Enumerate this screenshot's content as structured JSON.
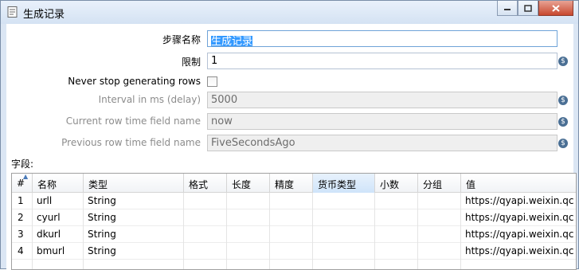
{
  "window": {
    "title": "生成记录",
    "controls": {
      "minimize": "▭",
      "maximize": "▢",
      "close": "✕"
    }
  },
  "form": {
    "step_name_label": "步骤名称",
    "step_name_value": "生成记录",
    "limit_label": "限制",
    "limit_value": "1",
    "never_stop_label": "Never stop generating rows",
    "interval_label": "Interval in ms (delay)",
    "interval_value": "5000",
    "current_row_time_label": "Current row time field name",
    "current_row_time_value": "now",
    "previous_row_time_label": "Previous row time field name",
    "previous_row_time_value": "FiveSecondsAgo",
    "variable_icon_glyph": "$"
  },
  "fields_section": {
    "label": "字段:",
    "columns": [
      "#",
      "名称",
      "类型",
      "格式",
      "长度",
      "精度",
      "货币类型",
      "小数",
      "分组",
      "值"
    ],
    "active_column": "货币类型",
    "rows": [
      {
        "num": "1",
        "name": "urll",
        "type": "String",
        "value": "https://qyapi.weixin.qc"
      },
      {
        "num": "2",
        "name": "cyurl",
        "type": "String",
        "value": "https://qyapi.weixin.qc"
      },
      {
        "num": "3",
        "name": "dkurl",
        "type": "String",
        "value": "https://qyapi.weixin.qc"
      },
      {
        "num": "4",
        "name": "bmurl",
        "type": "String",
        "value": "https://qyapi.weixin.qc"
      }
    ]
  }
}
